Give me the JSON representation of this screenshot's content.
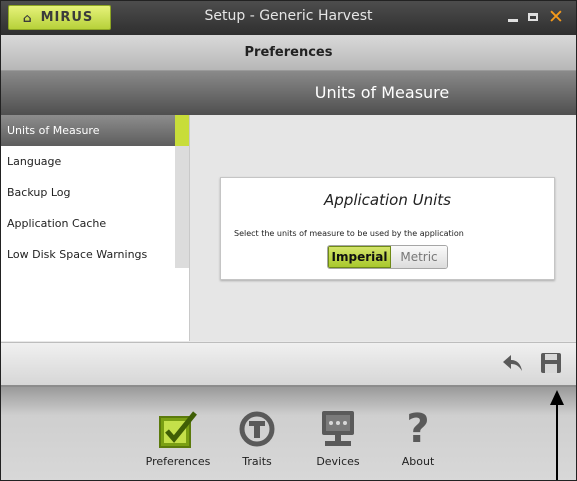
{
  "window": {
    "logo_text": "MIRUS",
    "title": "Setup - Generic Harvest",
    "controls": [
      "minimize-icon",
      "maximize-icon",
      "close-icon"
    ],
    "close_symbol": "✕"
  },
  "header": {
    "title": "Preferences"
  },
  "section": {
    "title": "Units of Measure"
  },
  "sidebar": {
    "items": [
      {
        "label": "Units of Measure",
        "selected": true
      },
      {
        "label": "Language",
        "selected": false
      },
      {
        "label": "Backup Log",
        "selected": false
      },
      {
        "label": "Application Cache",
        "selected": false
      },
      {
        "label": "Low Disk Space Warnings",
        "selected": false
      }
    ]
  },
  "units_card": {
    "title": "Application Units",
    "description": "Select the units of measure to be used by the application",
    "options": [
      "Imperial",
      "Metric"
    ],
    "selected": "Imperial"
  },
  "action_bar": {
    "buttons": [
      "undo-icon",
      "save-icon"
    ]
  },
  "toolbar": {
    "items": [
      {
        "label": "Preferences",
        "icon": "preferences-check-icon",
        "active": true
      },
      {
        "label": "Traits",
        "icon": "traits-icon",
        "active": false
      },
      {
        "label": "Devices",
        "icon": "devices-icon",
        "active": false
      },
      {
        "label": "About",
        "icon": "about-question-icon",
        "active": false
      }
    ]
  },
  "colors": {
    "accent_green": "#b7d13a",
    "close_orange": "#f59a1b",
    "icon_gray": "#5a5a5a"
  }
}
